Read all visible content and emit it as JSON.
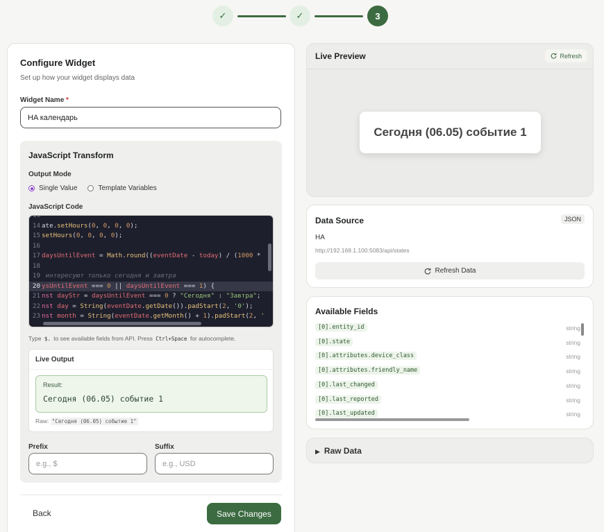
{
  "stepper": {
    "steps": [
      "✓",
      "✓",
      "3"
    ]
  },
  "configure": {
    "title": "Configure Widget",
    "subtitle": "Set up how your widget displays data",
    "widget_name_label": "Widget Name",
    "widget_name_required": "*",
    "widget_name_value": "HA календарь"
  },
  "transform": {
    "title": "JavaScript Transform",
    "output_mode_label": "Output Mode",
    "modes": [
      {
        "label": "Single Value",
        "checked": true
      },
      {
        "label": "Template Variables",
        "checked": false
      }
    ],
    "code_label": "JavaScript Code",
    "hint_pre": "Type",
    "hint_key": "$.",
    "hint_mid": "to see available fields from API. Press",
    "hint_shortcut": "Ctrl+Space",
    "hint_post": "for autocomplete."
  },
  "code_lines": [
    {
      "n": "13",
      "html": ""
    },
    {
      "n": "14",
      "html": "ate.<span class='c-f'>setHours</span>(<span class='c-n'>0</span>, <span class='c-n'>0</span>, <span class='c-n'>0</span>, <span class='c-n'>0</span>);"
    },
    {
      "n": "15",
      "html": "<span class='c-f'>setHours</span>(<span class='c-n'>0</span>, <span class='c-n'>0</span>, <span class='c-n'>0</span>, <span class='c-n'>0</span>);"
    },
    {
      "n": "16",
      "html": ""
    },
    {
      "n": "17",
      "html": "<span class='c-v'>daysUntilEvent</span> = <span class='c-f'>Math</span>.<span class='c-f'>round</span>((<span class='c-v'>eventDate</span> - <span class='c-v'>today</span>) / (<span class='c-n'>1000</span> *"
    },
    {
      "n": "18",
      "html": ""
    },
    {
      "n": "19",
      "html": "<span class='c-cm'> интересуют только сегодня и завтра</span>"
    },
    {
      "n": "20",
      "html": "<span class='c-v'>ysUntilEvent</span> === <span class='c-n'>0</span> || <span class='c-v'>daysUntilEvent</span> === <span class='c-n'>1</span>) {",
      "hl": true
    },
    {
      "n": "21",
      "html": "<span class='c-k'>nst</span> <span class='c-v'>dayStr</span> = <span class='c-v'>daysUntilEvent</span> === <span class='c-n'>0</span> ? <span class='c-s'>\"Сегодня\"</span> : <span class='c-s'>\"Завтра\"</span>;"
    },
    {
      "n": "22",
      "html": "<span class='c-k'>nst</span> <span class='c-v'>day</span> = <span class='c-f'>String</span>(<span class='c-v'>eventDate</span>.<span class='c-f'>getDate</span>()).<span class='c-f'>padStart</span>(<span class='c-n'>2</span>, <span class='c-s'>'0'</span>);"
    },
    {
      "n": "23",
      "html": "<span class='c-k'>nst</span> <span class='c-v'>month</span> = <span class='c-f'>String</span>(<span class='c-v'>eventDate</span>.<span class='c-f'>getMonth</span>() + <span class='c-n'>1</span>).<span class='c-f'>padStart</span>(<span class='c-n'>2</span>, <span class='c-s'>'</span>"
    }
  ],
  "live_output": {
    "title": "Live Output",
    "result_label": "Result:",
    "result_value": "Сегодня (06.05) событие 1",
    "raw_label": "Raw:",
    "raw_value": "\"Сегодня (06.05) событие 1\""
  },
  "prefix": {
    "label": "Prefix",
    "placeholder": "e.g., $"
  },
  "suffix": {
    "label": "Suffix",
    "placeholder": "e.g., USD"
  },
  "footer": {
    "back": "Back",
    "save": "Save Changes"
  },
  "preview": {
    "title": "Live Preview",
    "refresh": "Refresh",
    "value": "Сегодня (06.05) событие 1"
  },
  "data_source": {
    "title": "Data Source",
    "badge": "JSON",
    "name": "HA",
    "url": "http://192.168.1.100:5083/api/states",
    "refresh": "Refresh Data"
  },
  "available_fields": {
    "title": "Available Fields",
    "items": [
      {
        "path": "[0].entity_id",
        "type": "string"
      },
      {
        "path": "[0].state",
        "type": "string"
      },
      {
        "path": "[0].attributes.device_class",
        "type": "string"
      },
      {
        "path": "[0].attributes.friendly_name",
        "type": "string"
      },
      {
        "path": "[0].last_changed",
        "type": "string"
      },
      {
        "path": "[0].last_reported",
        "type": "string"
      },
      {
        "path": "[0].last_updated",
        "type": "string"
      }
    ]
  },
  "raw_data": {
    "label": "Raw Data"
  }
}
